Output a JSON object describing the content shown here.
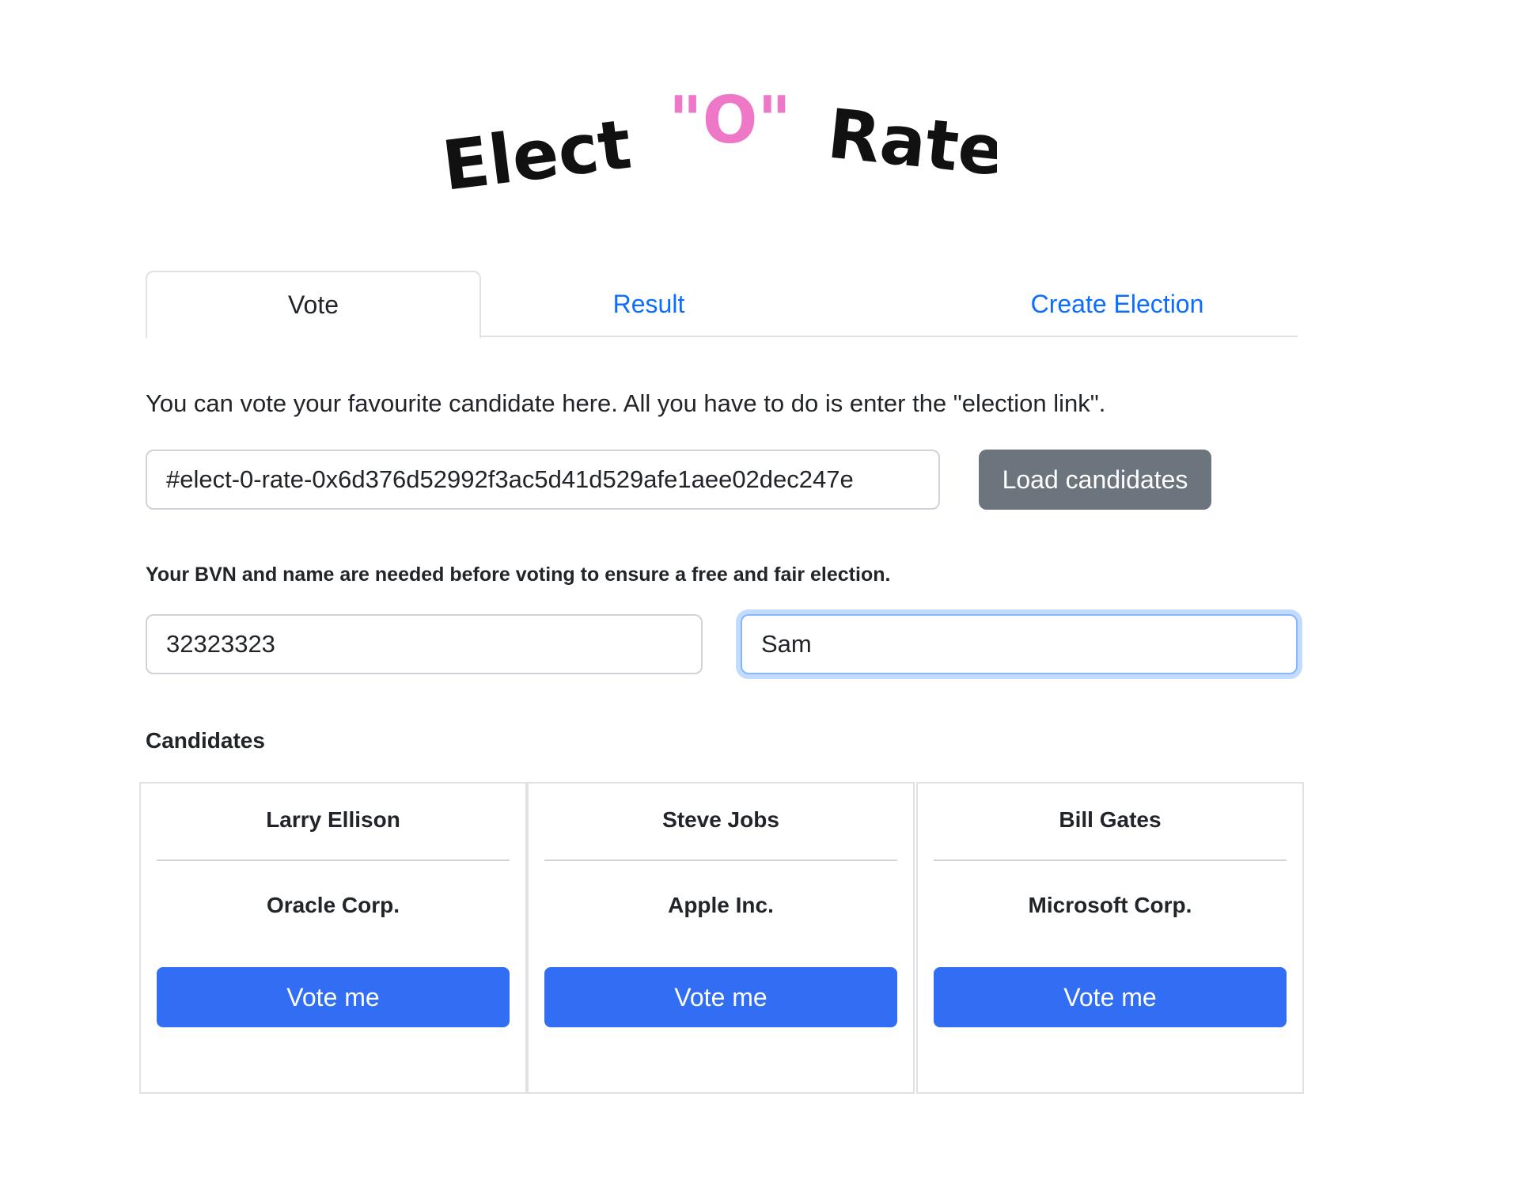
{
  "logo": {
    "part1": "Elect",
    "part2": "\"O\"",
    "part3": "Rate",
    "accent_color": "#ee77c8"
  },
  "tabs": [
    {
      "label": "Vote",
      "active": true
    },
    {
      "label": "Result",
      "active": false
    },
    {
      "label": "Create Election",
      "active": false
    }
  ],
  "vote": {
    "intro": "You can vote your favourite candidate here. All you have to do is enter the \"election link\".",
    "election_link_value": "#elect-0-rate-0x6d376d52992f3ac5d41d529afe1aee02dec247e",
    "load_button": "Load candidates",
    "bvn_note": "Your BVN and name are needed before voting to ensure a free and fair election.",
    "bvn_value": "32323323",
    "name_value": "Sam",
    "candidates_heading": "Candidates",
    "candidates": [
      {
        "name": "Larry Ellison",
        "company": "Oracle Corp.",
        "button": "Vote me"
      },
      {
        "name": "Steve Jobs",
        "company": "Apple Inc.",
        "button": "Vote me"
      },
      {
        "name": "Bill Gates",
        "company": "Microsoft Corp.",
        "button": "Vote me"
      }
    ]
  },
  "colors": {
    "primary": "#316ef4",
    "secondary": "#6c757d",
    "link": "#0d6efd"
  }
}
